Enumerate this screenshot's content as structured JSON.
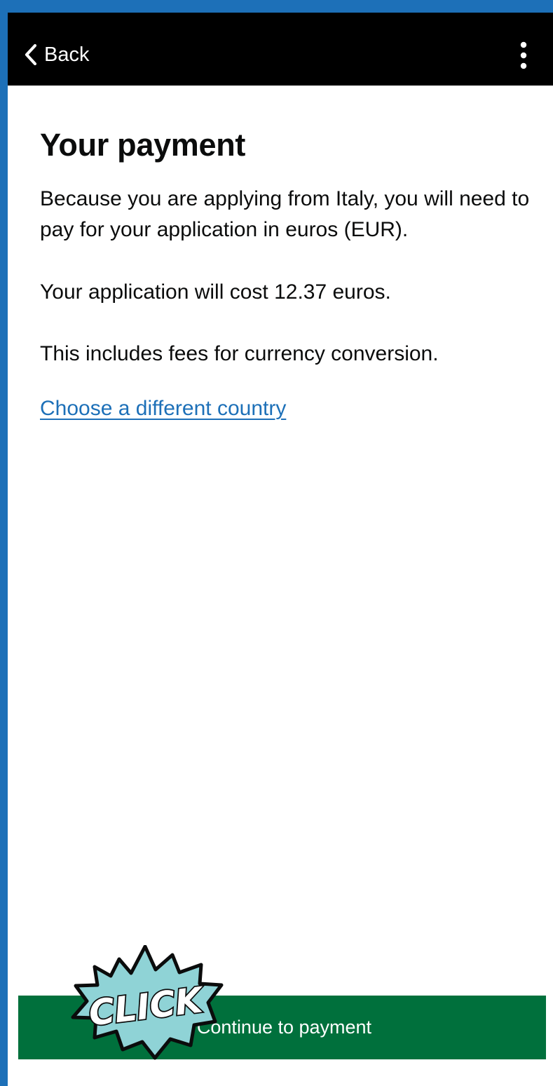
{
  "header": {
    "back_label": "Back",
    "back_icon": "chevron-left-icon",
    "menu_icon": "more-vertical-icon"
  },
  "main": {
    "title": "Your payment",
    "paragraphs": [
      "Because you are applying from Italy, you will need to pay for your application in euros (EUR).",
      "Your application will cost 12.37 euros.",
      "This includes fees for currency conversion."
    ],
    "change_country_link": "Choose a different country"
  },
  "footer": {
    "continue_label": "Continue to payment"
  },
  "overlay": {
    "click_badge_text": "CLICK"
  },
  "colors": {
    "outer_background": "#1d70b8",
    "header_background": "#000000",
    "link": "#1d70b8",
    "primary_button": "#00703c",
    "badge_fill": "#8fd3d6"
  }
}
